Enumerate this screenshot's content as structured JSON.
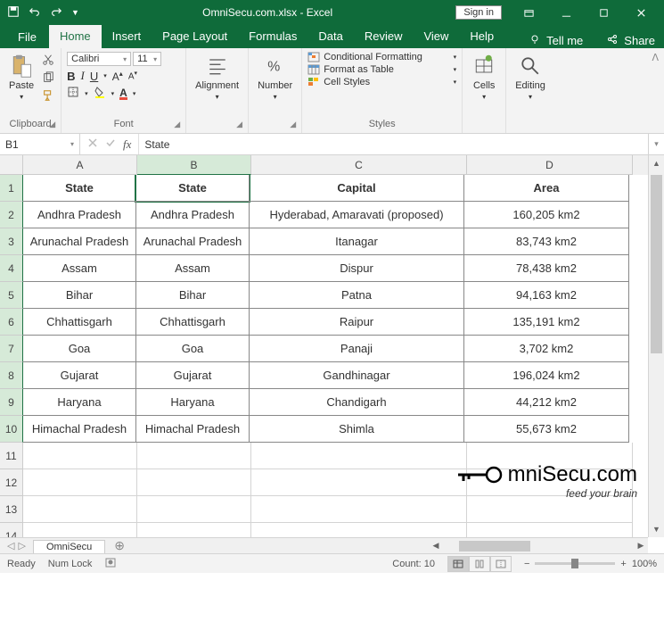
{
  "titlebar": {
    "title_main": "OmniSecu.com.xlsx",
    "title_sub": " - Excel",
    "signin": "Sign in"
  },
  "tabs": {
    "file": "File",
    "items": [
      "Home",
      "Insert",
      "Page Layout",
      "Formulas",
      "Data",
      "Review",
      "View",
      "Help"
    ],
    "tellme": "Tell me",
    "share": "Share"
  },
  "ribbon": {
    "clipboard": {
      "paste": "Paste",
      "label": "Clipboard"
    },
    "font": {
      "name": "Calibri",
      "size": "11",
      "label": "Font"
    },
    "alignment": {
      "btn": "Alignment"
    },
    "number": {
      "btn": "Number",
      "label": "Number"
    },
    "styles": {
      "cond": "Conditional Formatting",
      "table": "Format as Table",
      "cellstyles": "Cell Styles",
      "label": "Styles"
    },
    "cells": {
      "btn": "Cells"
    },
    "editing": {
      "btn": "Editing"
    }
  },
  "formula": {
    "namebox": "B1",
    "fx": "fx",
    "value": "State"
  },
  "columns": [
    "A",
    "B",
    "C",
    "D"
  ],
  "rows": [
    "1",
    "2",
    "3",
    "4",
    "5",
    "6",
    "7",
    "8",
    "9",
    "10",
    "11",
    "12",
    "13",
    "14"
  ],
  "grid": [
    [
      "State",
      "State",
      "Capital",
      "Area"
    ],
    [
      "Andhra Pradesh",
      "Andhra Pradesh",
      "Hyderabad, Amaravati (proposed)",
      "160,205 km2"
    ],
    [
      "Arunachal Pradesh",
      "Arunachal Pradesh",
      "Itanagar",
      "83,743 km2"
    ],
    [
      "Assam",
      "Assam",
      "Dispur",
      "78,438 km2"
    ],
    [
      "Bihar",
      "Bihar",
      "Patna",
      "94,163 km2"
    ],
    [
      "Chhattisgarh",
      "Chhattisgarh",
      "Raipur",
      "135,191 km2"
    ],
    [
      "Goa",
      "Goa",
      "Panaji",
      "3,702 km2"
    ],
    [
      "Gujarat",
      "Gujarat",
      "Gandhinagar",
      "196,024 km2"
    ],
    [
      "Haryana",
      "Haryana",
      "Chandigarh",
      "44,212 km2"
    ],
    [
      "Himachal Pradesh",
      "Himachal Pradesh",
      "Shimla",
      "55,673 km2"
    ],
    [
      "",
      "",
      "",
      ""
    ],
    [
      "",
      "",
      "",
      ""
    ],
    [
      "",
      "",
      "",
      ""
    ],
    [
      "",
      "",
      "",
      ""
    ]
  ],
  "sheettab": "OmniSecu",
  "status": {
    "ready": "Ready",
    "numlock": "Num Lock",
    "count": "Count: 10",
    "zoom": "100%"
  },
  "watermark": {
    "main": "mniSecu.com",
    "sub": "feed your brain"
  }
}
